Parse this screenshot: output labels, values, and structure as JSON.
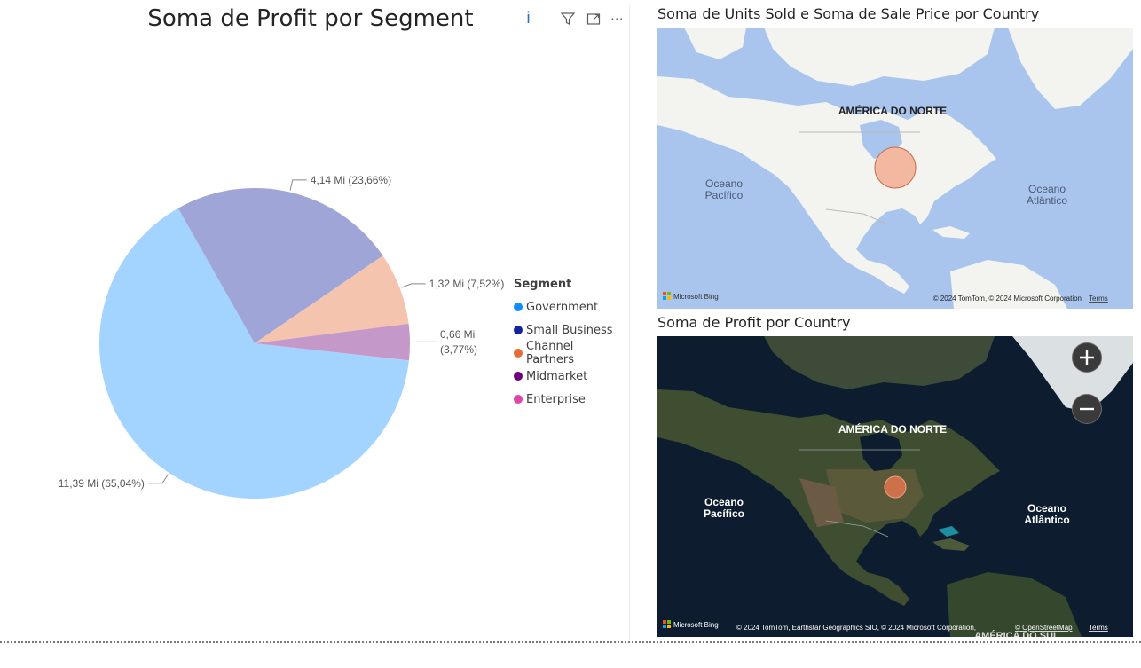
{
  "pie_visual": {
    "title": "Soma de Profit por Segment",
    "toolbar": {
      "info_label": "i",
      "filter_icon": "filter-icon",
      "focus_icon": "focus-mode-icon",
      "more_label": "⋯"
    },
    "legend": {
      "title": "Segment",
      "items": [
        {
          "label": "Government",
          "color": "#118dff"
        },
        {
          "label": "Small Business",
          "color": "#12239e"
        },
        {
          "label": "Channel Partners",
          "color": "#e66c37"
        },
        {
          "label": "Midmarket",
          "color": "#6b007b"
        },
        {
          "label": "Enterprise",
          "color": "#e044a7"
        }
      ]
    }
  },
  "chart_data": {
    "type": "pie",
    "title": "Soma de Profit por Segment",
    "legend_title": "Segment",
    "legend_position": "right",
    "slices": [
      {
        "label": "Government",
        "value": 11.39,
        "percent": 65.04,
        "color": "#a3d3ff",
        "data_label": [
          "11,39 Mi (65,04%)"
        ]
      },
      {
        "label": "Small Business",
        "value": 4.14,
        "percent": 23.66,
        "color": "#a0a5d8",
        "data_label": [
          "4,14 Mi (23,66%)"
        ]
      },
      {
        "label": "Channel Partners",
        "value": 1.32,
        "percent": 7.52,
        "color": "#f5c4af",
        "data_label": [
          "1,32 Mi (7,52%)"
        ]
      },
      {
        "label": "Midmarket",
        "value": 0.66,
        "percent": 3.77,
        "color": "#c499ca",
        "data_label": [
          "0,66 Mi",
          "(3,77%)"
        ]
      },
      {
        "label": "Enterprise",
        "value": 0.0,
        "percent": 0.01,
        "color": "#f0a8d6",
        "data_label": []
      }
    ]
  },
  "map_top": {
    "title": "Soma de Units Sold e Soma de Sale Price por Country",
    "continent_label": "AMÉRICA DO NORTE",
    "ocean_left": [
      "Oceano",
      "Pacífico"
    ],
    "ocean_right": [
      "Oceano",
      "Atlântico"
    ],
    "bing_label": "Microsoft Bing",
    "copyright": "© 2024 TomTom, © 2024 Microsoft Corporation",
    "terms": "Terms",
    "bubble_color": "#f2b8a0"
  },
  "map_bottom": {
    "title": "Soma de Profit por Country",
    "continent_label": "AMÉRICA DO NORTE",
    "continent_label_south": "AMÉRICA DO SUL",
    "ocean_left": [
      "Oceano",
      "Pacífico"
    ],
    "ocean_right": [
      "Oceano",
      "Atlântico"
    ],
    "bing_label": "Microsoft Bing",
    "copyright": "© 2024 TomTom, Earthstar Geographics SIO, © 2024 Microsoft Corporation,",
    "osm": "© OpenStreetMap",
    "terms": "Terms",
    "zoom_in": "+",
    "zoom_out": "−",
    "bubble_color": "#e0764e"
  }
}
